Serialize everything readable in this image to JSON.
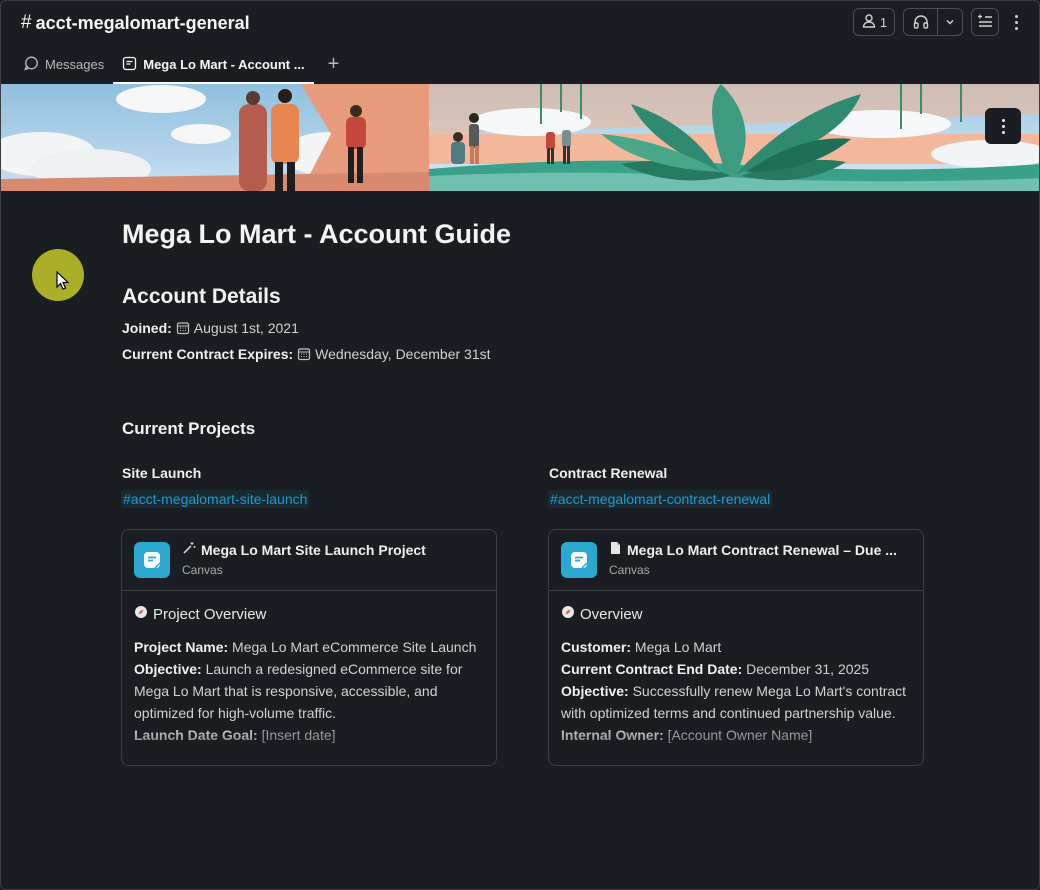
{
  "header": {
    "hash": "#",
    "channel_name": "acct-megalomart-general",
    "members_count": "1"
  },
  "tabs": {
    "messages_label": "Messages",
    "canvas_label": "Mega Lo Mart - Account ...",
    "add_label": "+"
  },
  "doc": {
    "title": "Mega Lo Mart - Account Guide",
    "account_details_heading": "Account Details",
    "joined_label": "Joined:",
    "joined_value": "August 1st, 2021",
    "expires_label": "Current Contract Expires:",
    "expires_value": "Wednesday, December 31st",
    "projects_heading": "Current Projects",
    "left": {
      "heading": "Site Launch",
      "channel": "#acct-megalomart-site-launch",
      "card_title": "Mega Lo Mart Site Launch Project",
      "card_sub": "Canvas",
      "section": "Project Overview",
      "l1_label": "Project Name:",
      "l1_value": " Mega Lo Mart eCommerce Site Launch",
      "l2_label": "Objective:",
      "l2_value": " Launch a redesigned eCommerce site for Mega Lo Mart that is responsive, accessible, and optimized for high-volume traffic.",
      "l3_label": "Launch Date Goal:",
      "l3_value": " [Insert date]"
    },
    "right": {
      "heading": "Contract Renewal",
      "channel": "#acct-megalomart-contract-renewal",
      "card_title": "Mega Lo Mart Contract Renewal – Due ...",
      "card_sub": "Canvas",
      "section": "Overview",
      "l1_label": "Customer:",
      "l1_value": " Mega Lo Mart",
      "l2_label": "Current Contract End Date:",
      "l2_value": " December 31, 2025",
      "l3_label": "Objective:",
      "l3_value": " Successfully renew Mega Lo Mart's contract with optimized terms and continued partnership value.",
      "l4_label": "Internal Owner:",
      "l4_value": " [Account Owner Name]"
    }
  },
  "colors": {
    "background": "#1a1d21",
    "link": "#1d9bd1",
    "canvas_tile": "#2aa8cf",
    "cursor_highlight": "#c8c828"
  }
}
